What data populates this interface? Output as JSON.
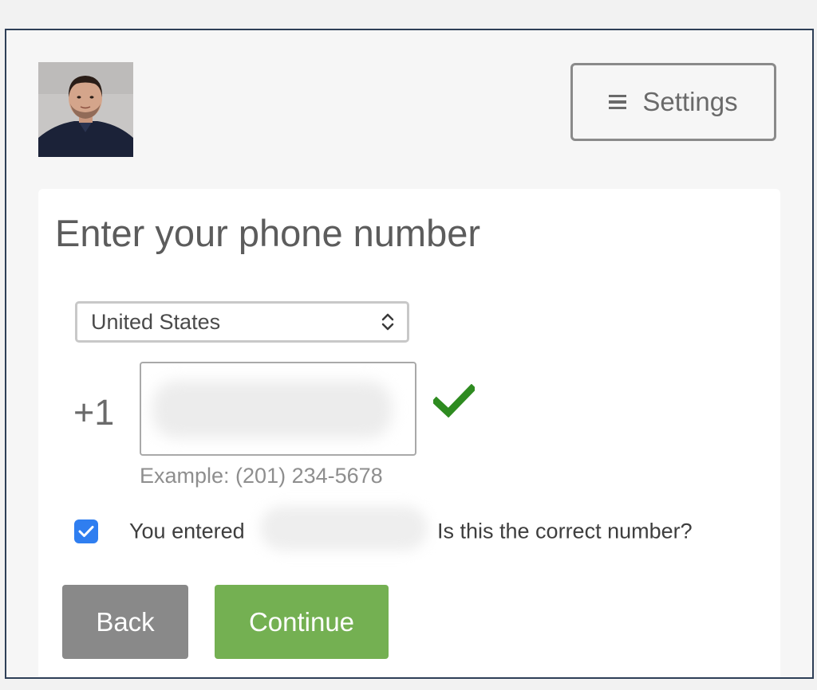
{
  "header": {
    "avatar_icon": "user-avatar-photo",
    "settings_icon": "hamburger-menu-icon",
    "settings_label": "Settings"
  },
  "form": {
    "title": "Enter your phone number",
    "country": {
      "selected": "United States",
      "icon": "up-down-chevron-icon"
    },
    "phone": {
      "prefix": "+1",
      "value": "",
      "valid_icon": "green-checkmark-icon",
      "example": "Example: (201) 234-5678"
    },
    "confirm": {
      "checked": true,
      "text_before": "You entered",
      "text_after": "Is this the correct number?"
    },
    "buttons": {
      "back_label": "Back",
      "continue_label": "Continue"
    }
  },
  "colors": {
    "continue": "#74b052",
    "back": "#898989",
    "valid_check": "#2e8b20",
    "checkbox": "#2f7ef0",
    "frame_border": "#2e3f57"
  }
}
